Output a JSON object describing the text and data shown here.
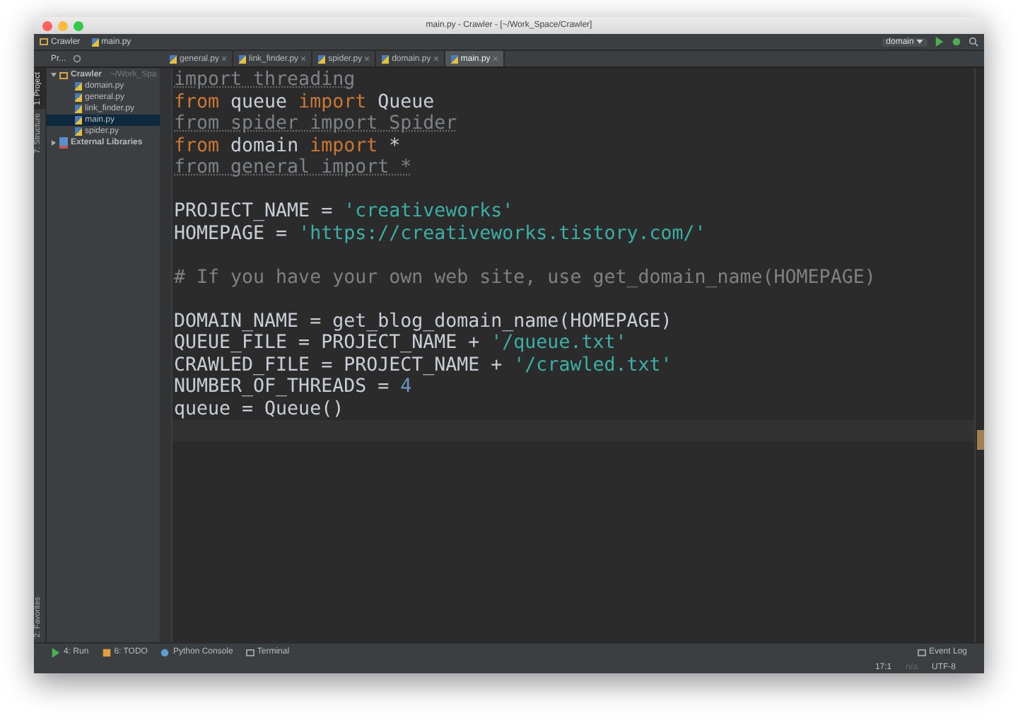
{
  "window": {
    "title": "main.py - Crawler - [~/Work_Space/Crawler]"
  },
  "breadcrumbs": [
    {
      "label": "Crawler",
      "kind": "folder"
    },
    {
      "label": "main.py",
      "kind": "file"
    }
  ],
  "run_config": {
    "label": "domain"
  },
  "project_toolbar": {
    "label": "Pr..."
  },
  "tabs": [
    {
      "label": "general.py",
      "selected": false
    },
    {
      "label": "link_finder.py",
      "selected": false
    },
    {
      "label": "spider.py",
      "selected": false
    },
    {
      "label": "domain.py",
      "selected": false
    },
    {
      "label": "main.py",
      "selected": true
    }
  ],
  "side_tabs": [
    {
      "label": "1: Project",
      "selected": true
    },
    {
      "label": "7: Structure",
      "selected": false
    }
  ],
  "side_tabs_bottom": [
    {
      "label": "2: Favorites",
      "selected": false
    }
  ],
  "tree": [
    {
      "label": "Crawler",
      "hint": "~/Work_Spa",
      "kind": "folder",
      "expanded": true,
      "selected": false,
      "children": [
        {
          "label": "domain.py",
          "kind": "file",
          "selected": false
        },
        {
          "label": "general.py",
          "kind": "file",
          "selected": false
        },
        {
          "label": "link_finder.py",
          "kind": "file",
          "selected": false
        },
        {
          "label": "main.py",
          "kind": "file",
          "selected": true
        },
        {
          "label": "spider.py",
          "kind": "file",
          "selected": false
        }
      ]
    },
    {
      "label": "External Libraries",
      "kind": "library",
      "expanded": false,
      "selected": false
    }
  ],
  "code": [
    {
      "kind": "code",
      "tokens": [
        {
          "text": "import threading",
          "kind": "unused"
        }
      ]
    },
    {
      "kind": "code",
      "tokens": [
        {
          "text": "from",
          "kind": "keyword"
        },
        {
          "text": " queue ",
          "kind": "name"
        },
        {
          "text": "import",
          "kind": "keyword"
        },
        {
          "text": " Queue",
          "kind": "name"
        }
      ]
    },
    {
      "kind": "code",
      "tokens": [
        {
          "text": "from spider import Spider",
          "kind": "unused"
        }
      ]
    },
    {
      "kind": "code",
      "tokens": [
        {
          "text": "from",
          "kind": "keyword"
        },
        {
          "text": " domain ",
          "kind": "name"
        },
        {
          "text": "import",
          "kind": "keyword"
        },
        {
          "text": " *",
          "kind": "name"
        }
      ]
    },
    {
      "kind": "code",
      "tokens": [
        {
          "text": "from general import *",
          "kind": "unused"
        }
      ]
    },
    {
      "kind": "blank"
    },
    {
      "kind": "code",
      "tokens": [
        {
          "text": "PROJECT_NAME = ",
          "kind": "name"
        },
        {
          "text": "'creativeworks'",
          "kind": "string"
        }
      ]
    },
    {
      "kind": "code",
      "tokens": [
        {
          "text": "HOMEPAGE = ",
          "kind": "name"
        },
        {
          "text": "'https://creativeworks.tistory.com/'",
          "kind": "string"
        }
      ]
    },
    {
      "kind": "blank"
    },
    {
      "kind": "code",
      "tokens": [
        {
          "text": "# If you have your own web site, use get_domain_name(HOMEPAGE)",
          "kind": "comment"
        }
      ]
    },
    {
      "kind": "blank"
    },
    {
      "kind": "code",
      "tokens": [
        {
          "text": "DOMAIN_NAME = get_blog_domain_name(HOMEPAGE)",
          "kind": "name"
        }
      ]
    },
    {
      "kind": "code",
      "tokens": [
        {
          "text": "QUEUE_FILE = PROJECT_NAME + ",
          "kind": "name"
        },
        {
          "text": "'/queue.txt'",
          "kind": "string"
        }
      ]
    },
    {
      "kind": "code",
      "tokens": [
        {
          "text": "CRAWLED_FILE = PROJECT_NAME + ",
          "kind": "name"
        },
        {
          "text": "'/crawled.txt'",
          "kind": "string"
        }
      ]
    },
    {
      "kind": "code",
      "tokens": [
        {
          "text": "NUMBER_OF_THREADS = ",
          "kind": "name"
        },
        {
          "text": "4",
          "kind": "number"
        }
      ]
    },
    {
      "kind": "code",
      "tokens": [
        {
          "text": "queue = Queue()",
          "kind": "name"
        }
      ]
    }
  ],
  "tool_windows": [
    {
      "label": "4: Run",
      "kind": "run"
    },
    {
      "label": "6: TODO",
      "kind": "todo"
    },
    {
      "label": "Python Console",
      "kind": "console"
    },
    {
      "label": "Terminal",
      "kind": "terminal"
    }
  ],
  "event_log": {
    "label": "Event Log"
  },
  "status_bar": {
    "position": "17:1",
    "separator": "n/a",
    "encoding": "UTF-8"
  }
}
